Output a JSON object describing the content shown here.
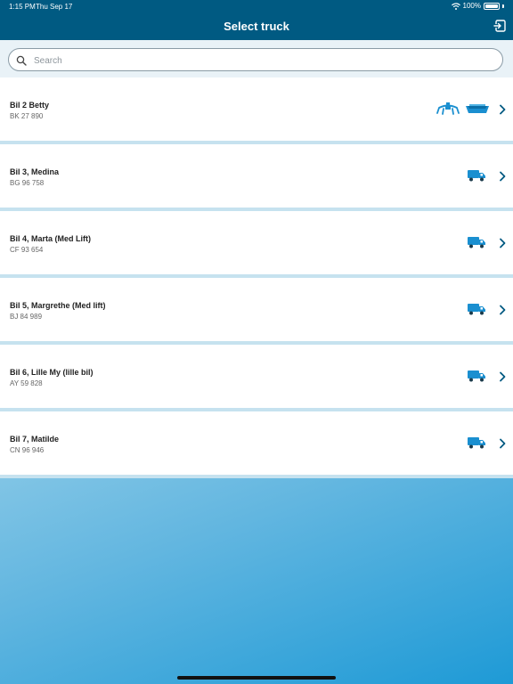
{
  "status_bar": {
    "time": "1:15 PM",
    "date": "Thu Sep 17",
    "battery": "100%"
  },
  "header": {
    "title": "Select truck"
  },
  "search": {
    "placeholder": "Search",
    "value": ""
  },
  "trucks": [
    {
      "name": "Bil 2 Betty",
      "plate": "BK 27 890",
      "icons": [
        "crane-icon",
        "boat-icon"
      ]
    },
    {
      "name": "Bil 3, Medina",
      "plate": "BG 96 758",
      "icons": [
        "truck-icon"
      ]
    },
    {
      "name": "Bil 4, Marta (Med Lift)",
      "plate": "CF 93 654",
      "icons": [
        "truck-icon"
      ]
    },
    {
      "name": "Bil 5, Margrethe (Med lift)",
      "plate": "BJ 84 989",
      "icons": [
        "truck-icon"
      ]
    },
    {
      "name": "Bil 6, Lille My (lille bil)",
      "plate": "AY 59 828",
      "icons": [
        "truck-icon"
      ]
    },
    {
      "name": "Bil 7, Matilde",
      "plate": "CN 96 946",
      "icons": [
        "truck-icon"
      ]
    }
  ],
  "colors": {
    "header": "#005a82",
    "icon_blue": "#1a8fd0",
    "chevron": "#005a82"
  }
}
